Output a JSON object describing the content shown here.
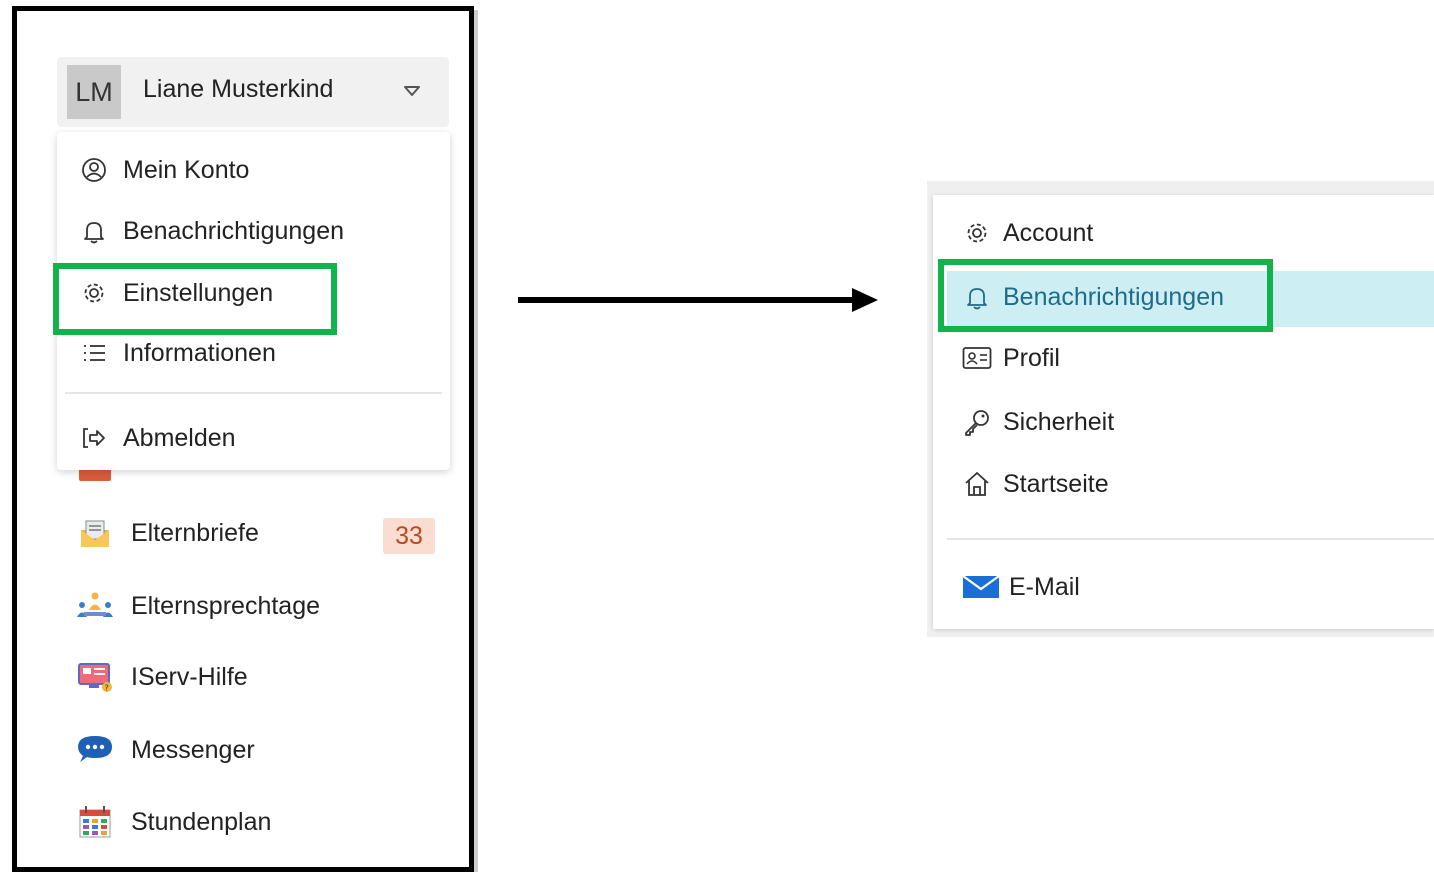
{
  "user_menu": {
    "avatar_initials": "LM",
    "user_name": "Liane Musterkind",
    "items": [
      {
        "label": "Mein Konto",
        "icon": "user-circle-icon"
      },
      {
        "label": "Benachrichtigungen",
        "icon": "bell-icon"
      },
      {
        "label": "Einstellungen",
        "icon": "gear-icon"
      },
      {
        "label": "Informationen",
        "icon": "list-icon"
      }
    ],
    "logout": {
      "label": "Abmelden",
      "icon": "logout-icon"
    }
  },
  "nav": {
    "items": [
      {
        "label": "Elternbriefe",
        "icon": "envelope-letter-icon",
        "badge": "33"
      },
      {
        "label": "Elternsprechtage",
        "icon": "people-meeting-icon"
      },
      {
        "label": "IServ-Hilfe",
        "icon": "help-screen-icon"
      },
      {
        "label": "Messenger",
        "icon": "chat-bubble-icon"
      },
      {
        "label": "Stundenplan",
        "icon": "calendar-icon"
      }
    ]
  },
  "settings_menu": {
    "items": [
      {
        "label": "Account",
        "icon": "gear-icon"
      },
      {
        "label": "Benachrichtigungen",
        "icon": "bell-icon",
        "active": true
      },
      {
        "label": "Profil",
        "icon": "id-card-icon"
      },
      {
        "label": "Sicherheit",
        "icon": "key-icon"
      },
      {
        "label": "Startseite",
        "icon": "home-icon"
      }
    ],
    "email": {
      "label": "E-Mail",
      "icon": "mail-icon"
    }
  },
  "colors": {
    "highlight_green": "#12b34a",
    "active_bg": "#cdeff4",
    "active_text": "#1f6b8a",
    "badge_bg": "#fbdcd0",
    "badge_text": "#b84a22"
  }
}
